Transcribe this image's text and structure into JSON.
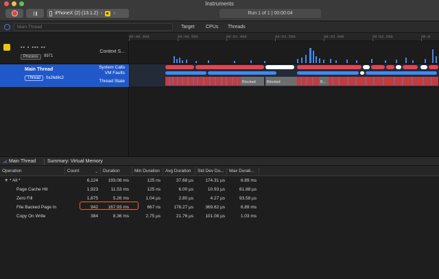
{
  "window": {
    "title": "Instruments"
  },
  "toolbar": {
    "device_label": "iPhoneX (2) (13.1.2)",
    "chevron": "›",
    "run_status": "Run 1 of 1  |  00:00:04"
  },
  "filter": {
    "placeholder": "Main Thread",
    "tabs": [
      "Target",
      "CPUs",
      "Threads"
    ]
  },
  "ruler": {
    "ticks": [
      "00:00.000",
      "00:00.500",
      "00:01.000",
      "00:01.500",
      "00:02.000",
      "00:02.500",
      "00:0"
    ]
  },
  "process": {
    "name": "▪▪ ▪ ▪▪▪ ▪▪",
    "tag": "Process",
    "pid": "8971",
    "context_label": "Context S..."
  },
  "thread": {
    "name": "Main Thread",
    "tag": "Thread",
    "id": "0x26d8c2",
    "lanes": [
      "System Calls",
      "VM Faults",
      "Thread State"
    ],
    "state_labels": [
      "Blocked",
      "Blocked",
      "B..."
    ]
  },
  "detail_bar": {
    "thread": "Main Thread",
    "summary": "Summary: Virtual Memory"
  },
  "table": {
    "headers": [
      "Operation",
      "Count",
      "Duration",
      "Min Duration",
      "Avg Duration",
      "Std Dev Du...",
      "Max Durati..."
    ],
    "sort_indicator": "⌄",
    "rows": [
      {
        "op": "* All *",
        "disclosure": "▼",
        "count": "6,124",
        "duration": "193.08 ms",
        "min": "125 ns",
        "avg": "37.68 µs",
        "std": "174.31 µs",
        "max": "6.89 ms"
      },
      {
        "op": "Page Cache Hit",
        "disclosure": "",
        "count": "1,923",
        "duration": "11.53 ms",
        "min": "125 ns",
        "avg": "6.00 µs",
        "std": "10.93 µs",
        "max": "61.88 µs"
      },
      {
        "op": "Zero Fill",
        "disclosure": "",
        "count": "1,875",
        "duration": "5.26 ms",
        "min": "1.04 µs",
        "avg": "2.80 µs",
        "std": "4.27 µs",
        "max": "93.58 µs"
      },
      {
        "op": "File Backed Page In",
        "disclosure": "",
        "count": "942",
        "duration": "167.93 ms",
        "min": "667 ns",
        "avg": "178.27 µs",
        "std": "369.62 µs",
        "max": "6.89 ms"
      },
      {
        "op": "Copy On Write",
        "disclosure": "",
        "count": "384",
        "duration": "8.36 ms",
        "min": "2.75 µs",
        "avg": "21.76 µs",
        "std": "101.08 µs",
        "max": "1.03 ms"
      }
    ]
  },
  "colors": {
    "accent": "#2158c9",
    "syscall": "#e9434b",
    "vmfault": "#3f8bf2",
    "highlight": "#e5683a"
  }
}
